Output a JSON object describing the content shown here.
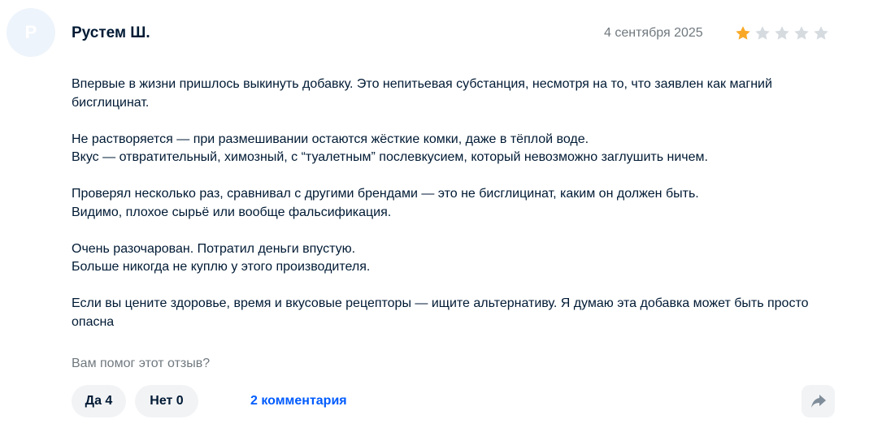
{
  "review": {
    "avatar_letter": "Р",
    "author": "Рустем Ш.",
    "date": "4 сентября 2025",
    "rating": 1,
    "max_rating": 5,
    "colors": {
      "star_filled": "#f9a825",
      "star_empty": "#d6dbe0",
      "link": "#005bff"
    },
    "paragraphs": [
      "Впервые в жизни пришлось выкинуть добавку. Это непитьевая субстанция, несмотря на то, что заявлен как магний бисглицинат.",
      "Не растворяется — при размешивании остаются жёсткие комки, даже в тёплой воде.\nВкус — отвратительный, химозный, с “туалетным” послевкусием, который невозможно заглушить ничем.",
      "Проверял несколько раз, сравнивал с другими брендами — это не бисглицинат, каким он должен быть.\nВидимо, плохое сырьё или вообще фальсификация.",
      "Очень разочарован. Потратил деньги впустую.\nБольше никогда не куплю у этого производителя.",
      "Если вы цените здоровье, время и вкусовые рецепторы — ищите альтернативу. Я думаю эта добавка может быть просто опасна"
    ]
  },
  "feedback": {
    "question": "Вам помог этот отзыв?",
    "yes_label": "Да 4",
    "no_label": "Нет 0",
    "comments_label": "2 комментария",
    "share_icon": "share-arrow-icon"
  }
}
